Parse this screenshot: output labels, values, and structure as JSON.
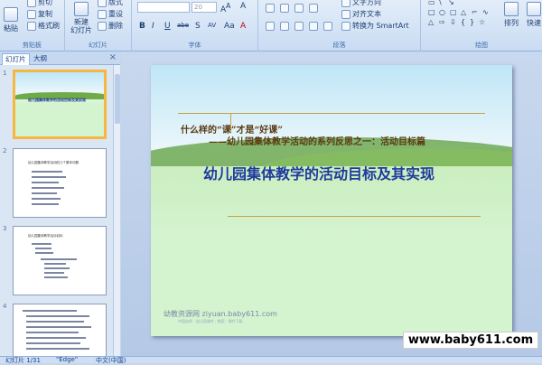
{
  "ribbon": {
    "clipboard": {
      "paste": "粘贴",
      "cut": "剪切",
      "copy": "复制",
      "format_painter": "格式刷",
      "label": "剪贴板"
    },
    "slides": {
      "new_slide": "新建\n幻灯片",
      "layout": "版式",
      "reset": "重设",
      "delete": "删除",
      "label": "幻灯片"
    },
    "font": {
      "font_size": "20",
      "label": "字体",
      "buttons": [
        "B",
        "I",
        "U",
        "abe",
        "S",
        "AV",
        "Aa",
        "A"
      ]
    },
    "paragraph": {
      "text_direction": "文字方向",
      "align_text": "对齐文本",
      "smartart": "转换为 SmartArt",
      "label": "段落"
    },
    "drawing": {
      "arrange": "排列",
      "quick_styles": "快速",
      "label": "绘图"
    }
  },
  "leftpane": {
    "tabs": [
      {
        "label": "幻灯片"
      },
      {
        "label": "大纲"
      }
    ],
    "close": "×",
    "slides": [
      {
        "num": "1",
        "title": "幼儿园集体教学的活动目标及其实现"
      },
      {
        "num": "2",
        "title": "幼儿园集体教学活动的几个基本问题"
      },
      {
        "num": "3",
        "title": "幼儿园集体教学活动目标"
      },
      {
        "num": "4",
        "title": ""
      }
    ]
  },
  "slide": {
    "line1": "什么样的“课”才是“好课”",
    "line2": "——幼儿园集体教学活动的系列反思之一：活动目标篇",
    "title": "幼儿园集体教学的活动目标及其实现",
    "footer": "幼教资源网 ziyuan.baby611.com",
    "footer_sub": "中国幼师 · 幼儿园课件 · 教案 · 课件下载"
  },
  "watermark": "www.baby611.com",
  "statusbar": {
    "slide_info": "幻灯片 1/31",
    "theme": "\"Edge\"",
    "language": "中文(中国)"
  }
}
